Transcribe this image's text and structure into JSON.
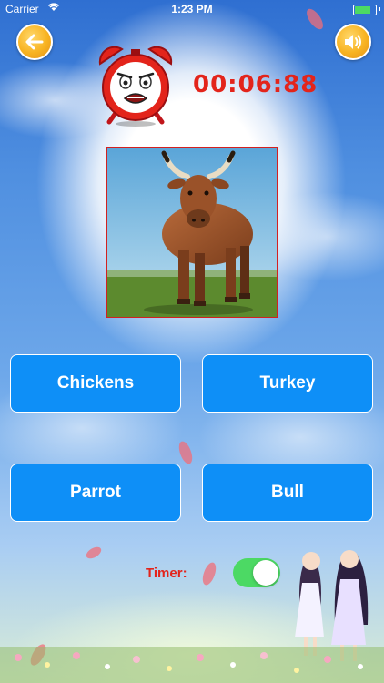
{
  "status_bar": {
    "carrier": "Carrier",
    "time": "1:23 PM",
    "battery_level": 0.85
  },
  "header": {
    "back_icon": "back-arrow-icon",
    "sound_icon": "speaker-icon"
  },
  "quiz": {
    "clock_icon": "alarm-clock-icon",
    "timer_value": "00:06:88",
    "image": "bull-photo",
    "answers": [
      "Chickens",
      "Turkey",
      "Parrot",
      "Bull"
    ]
  },
  "footer": {
    "timer_label": "Timer:",
    "timer_enabled": true
  },
  "colors": {
    "accent": "#f8b321",
    "button": "#0e8ff7",
    "timer_text": "#e3241b",
    "toggle_on": "#4cd964"
  }
}
